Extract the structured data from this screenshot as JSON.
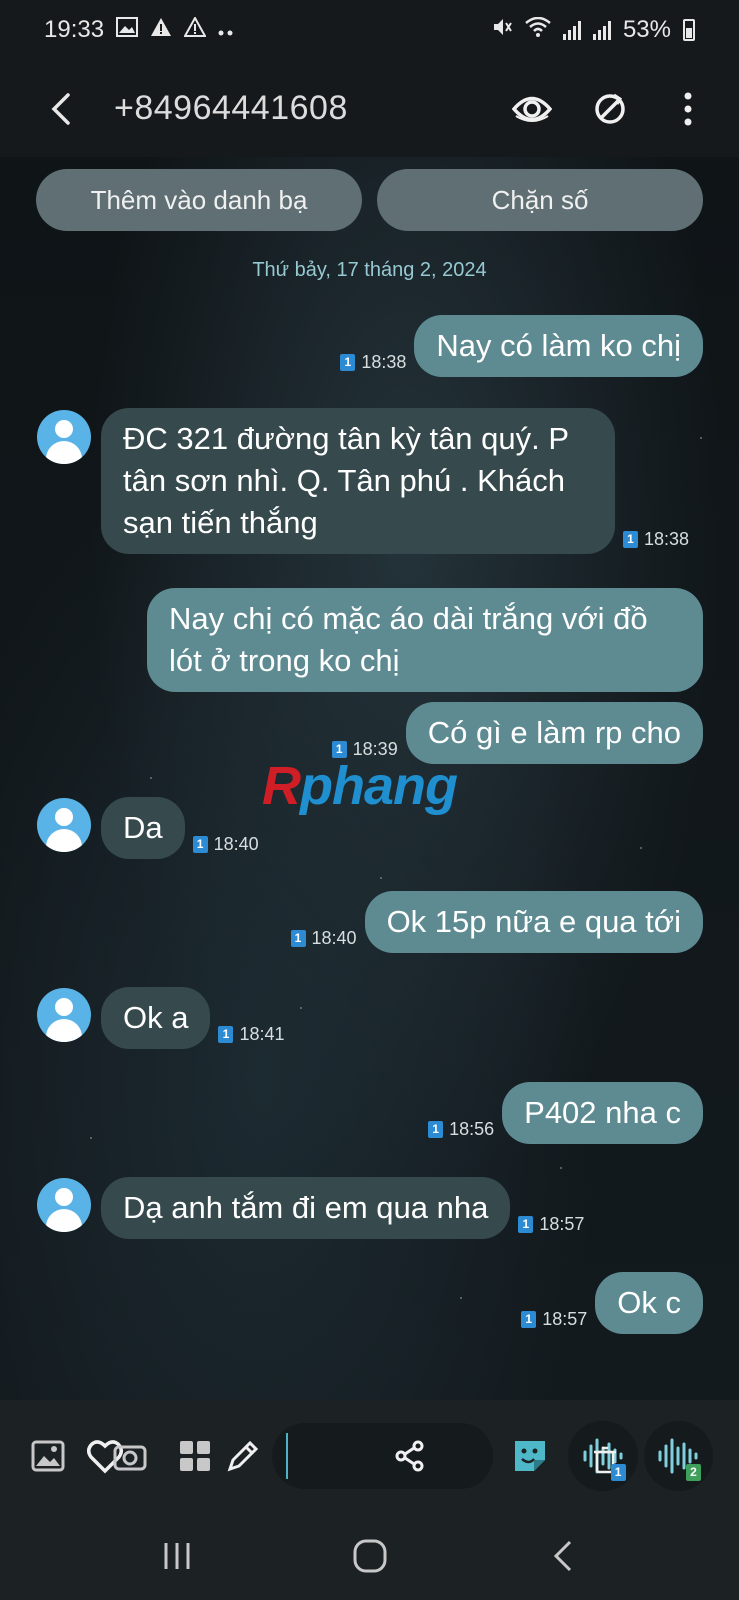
{
  "status_bar": {
    "time": "19:33",
    "battery": "53%",
    "icons": [
      "gallery-icon",
      "warning-icon",
      "warning-icon",
      "more-dots-icon",
      "mute-icon",
      "wifi-icon",
      "signal-icon",
      "signal-icon",
      "battery-icon"
    ]
  },
  "header": {
    "title": "+84964441608",
    "icons": [
      "back-icon",
      "eye-icon",
      "video-call-icon",
      "more-vert-icon"
    ]
  },
  "actions": {
    "add_contact": "Thêm vào danh bạ",
    "block": "Chặn số"
  },
  "date_separator": "Thứ bảy, 17 tháng 2, 2024",
  "messages": [
    {
      "direction": "outgoing",
      "text": "Nay có làm ko chị",
      "sim": "1",
      "time": "18:38"
    },
    {
      "direction": "incoming",
      "text": "ĐC 321 đường tân kỳ tân quý.  P tân sơn nhì.  Q.  Tân phú . Khách sạn  tiến thắng",
      "sim": "1",
      "time": "18:38"
    },
    {
      "direction": "outgoing",
      "text": "Nay chị có mặc áo dài trắng với đồ lót ở trong ko chị",
      "sim": "",
      "time": ""
    },
    {
      "direction": "outgoing",
      "text": "Có gì e làm rp cho",
      "sim": "1",
      "time": "18:39"
    },
    {
      "direction": "incoming",
      "text": "Da",
      "sim": "1",
      "time": "18:40"
    },
    {
      "direction": "outgoing",
      "text": "Ok 15p nữa e qua tới",
      "sim": "1",
      "time": "18:40"
    },
    {
      "direction": "incoming",
      "text": "Ok a",
      "sim": "1",
      "time": "18:41"
    },
    {
      "direction": "outgoing",
      "text": "P402 nha c",
      "sim": "1",
      "time": "18:56"
    },
    {
      "direction": "incoming",
      "text": "Dạ anh tắm đi em qua nha",
      "sim": "1",
      "time": "18:57"
    },
    {
      "direction": "outgoing",
      "text": "Ok c",
      "sim": "1",
      "time": "18:57"
    }
  ],
  "watermark": {
    "first": "R",
    "rest": "phang"
  },
  "composer": {
    "icons": [
      "image-icon",
      "heart-camera-icon",
      "apps-icon",
      "pencil-icon",
      "share-icon",
      "sticker-icon",
      "voice-sim1-icon",
      "voice-sim2-icon"
    ],
    "sim1_badge": "1",
    "sim2_badge": "2"
  },
  "nav": {
    "icons": [
      "recents-icon",
      "home-icon",
      "back-nav-icon"
    ]
  },
  "colors": {
    "outgoing_bubble": "#5e8b92",
    "incoming_bubble": "#36494d",
    "sim_badge": "#2d8bd4",
    "sim2_badge": "#3ea05a",
    "date_text": "#97c9d3",
    "avatar": "#5ab3e6"
  }
}
